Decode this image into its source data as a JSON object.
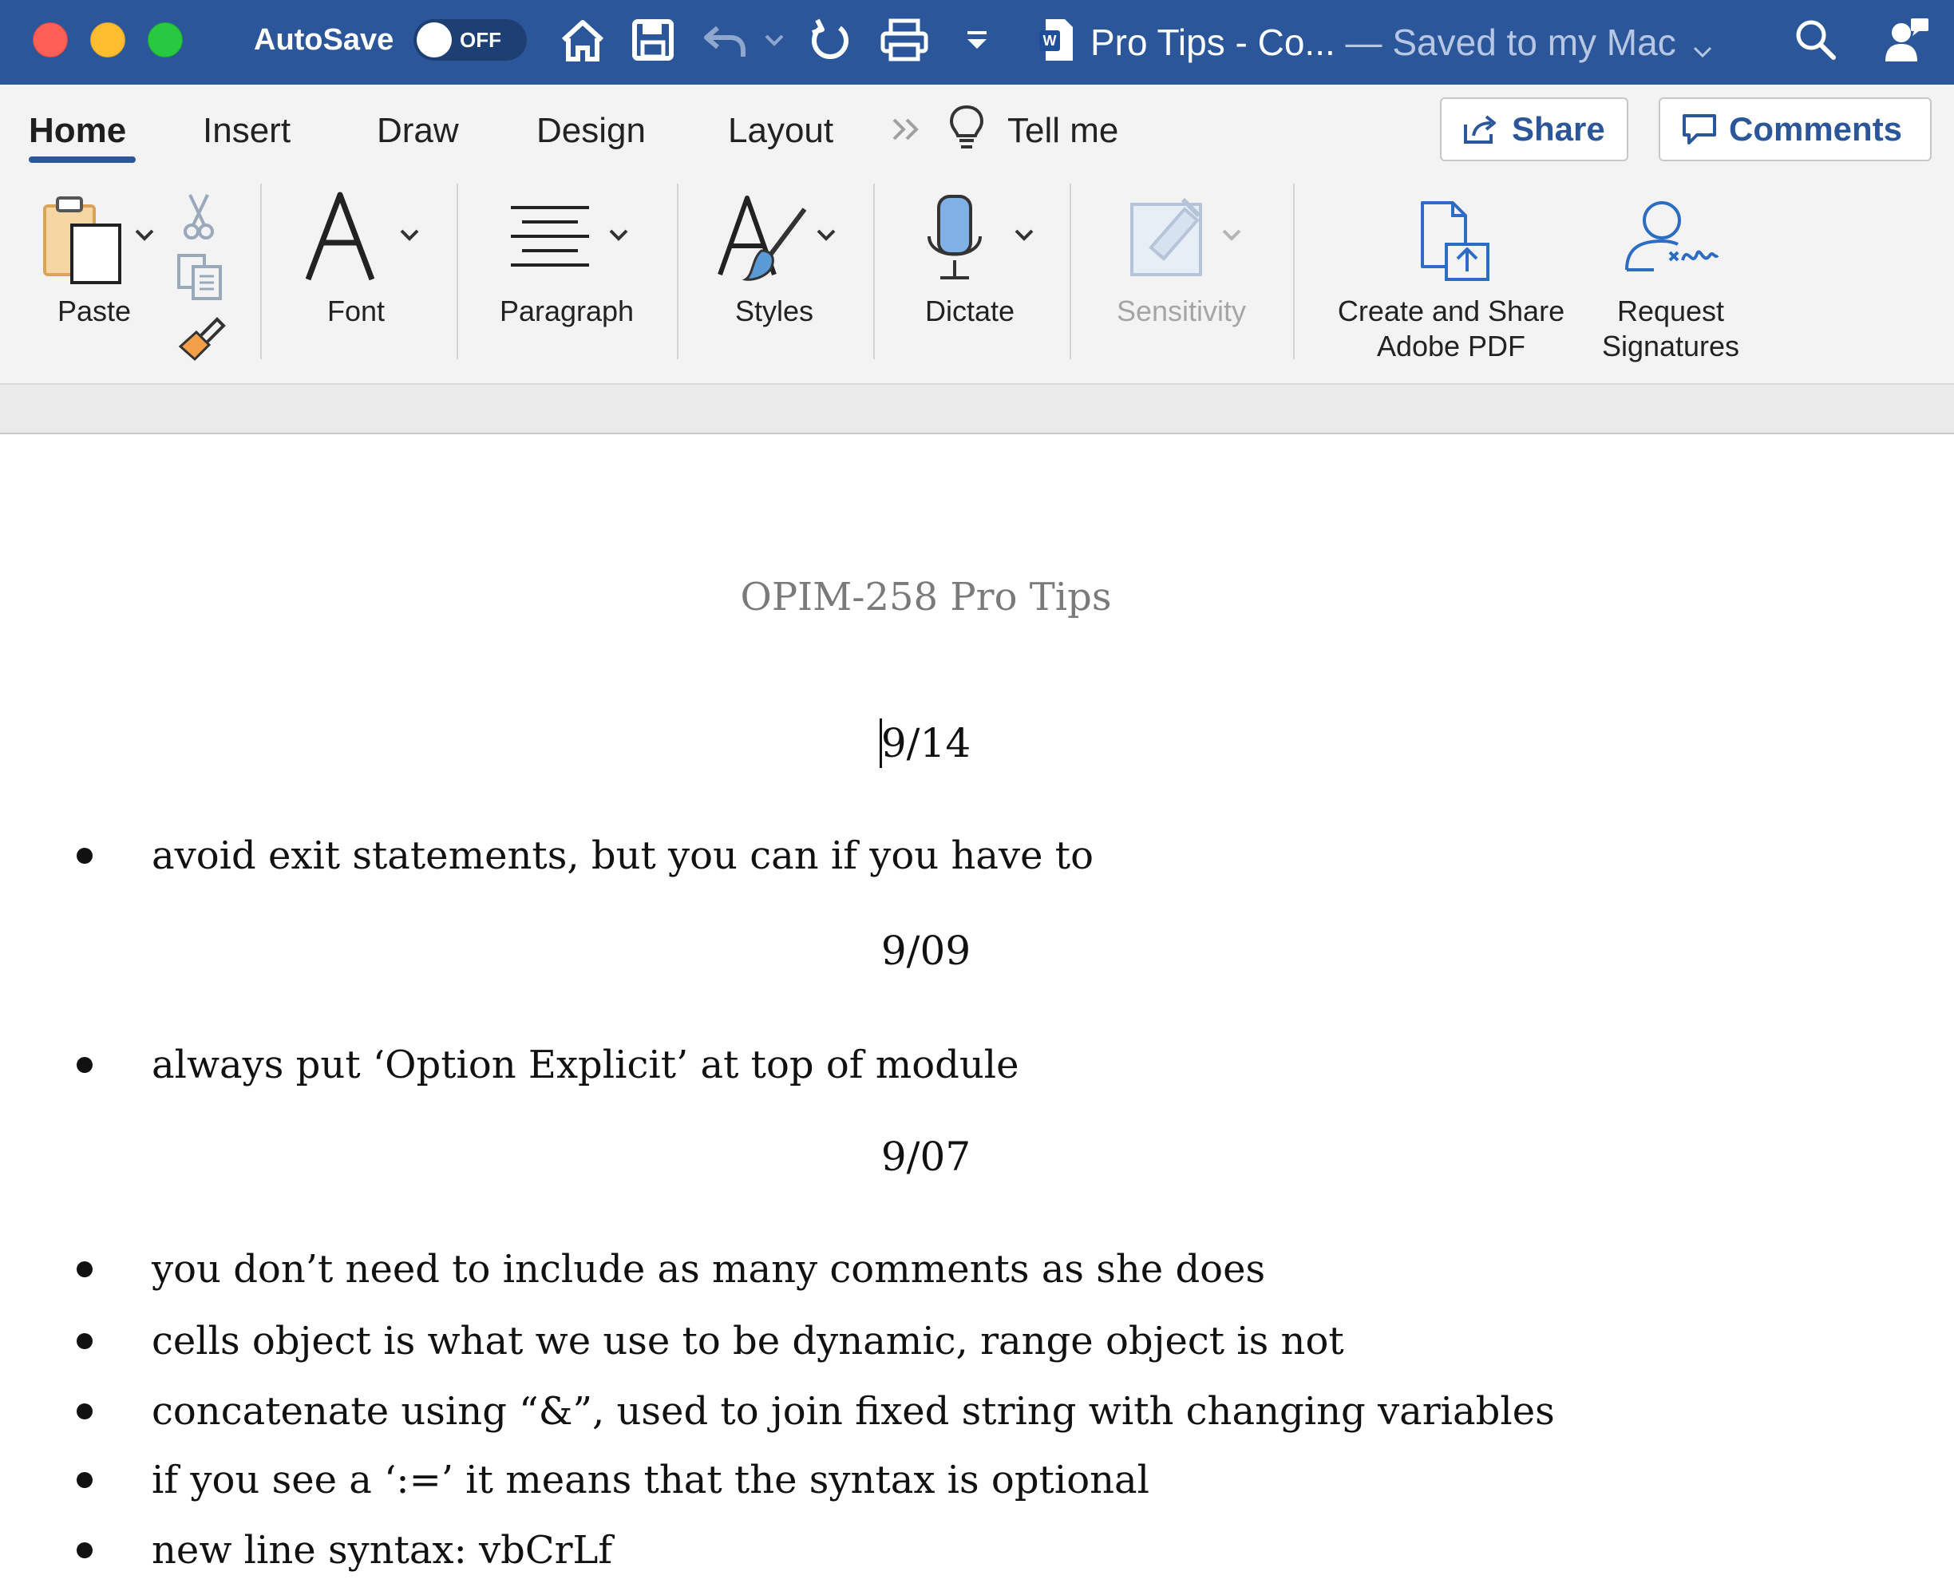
{
  "titlebar": {
    "autosave_label": "AutoSave",
    "autosave_state": "OFF",
    "doc_title": "Pro Tips",
    "doc_title_sep": " - ",
    "doc_title_more": "Co...",
    "saved_status": " — Saved to my Mac",
    "bg_color": "#2b579a"
  },
  "menu": {
    "tabs": [
      {
        "label": "Home"
      },
      {
        "label": "Insert"
      },
      {
        "label": "Draw"
      },
      {
        "label": "Design"
      },
      {
        "label": "Layout"
      },
      {
        "label": "Tell me"
      }
    ],
    "share_label": "Share",
    "comments_label": "Comments"
  },
  "ribbon": {
    "paste": "Paste",
    "font": "Font",
    "paragraph": "Paragraph",
    "styles": "Styles",
    "dictate": "Dictate",
    "sensitivity": "Sensitivity",
    "adobe_line1": "Create and Share",
    "adobe_line2": "Adobe PDF",
    "request_line1": "Request",
    "request_line2": "Signatures"
  },
  "document": {
    "title": "OPIM-258 Pro Tips",
    "sections": [
      {
        "date": "9/14",
        "bullets": [
          "avoid exit statements, but you can if you have to"
        ]
      },
      {
        "date": "9/09",
        "bullets": [
          "always put ‘Option Explicit’ at top of module"
        ]
      },
      {
        "date": "9/07",
        "bullets": [
          "you don’t need to include as many comments as she does",
          "cells object is what we use to be dynamic, range object is not",
          "concatenate using “&”, used to join fixed string with changing variables",
          "if you see a ‘:=’ it means that the syntax is optional",
          "new line syntax: vbCrLf"
        ]
      }
    ]
  }
}
